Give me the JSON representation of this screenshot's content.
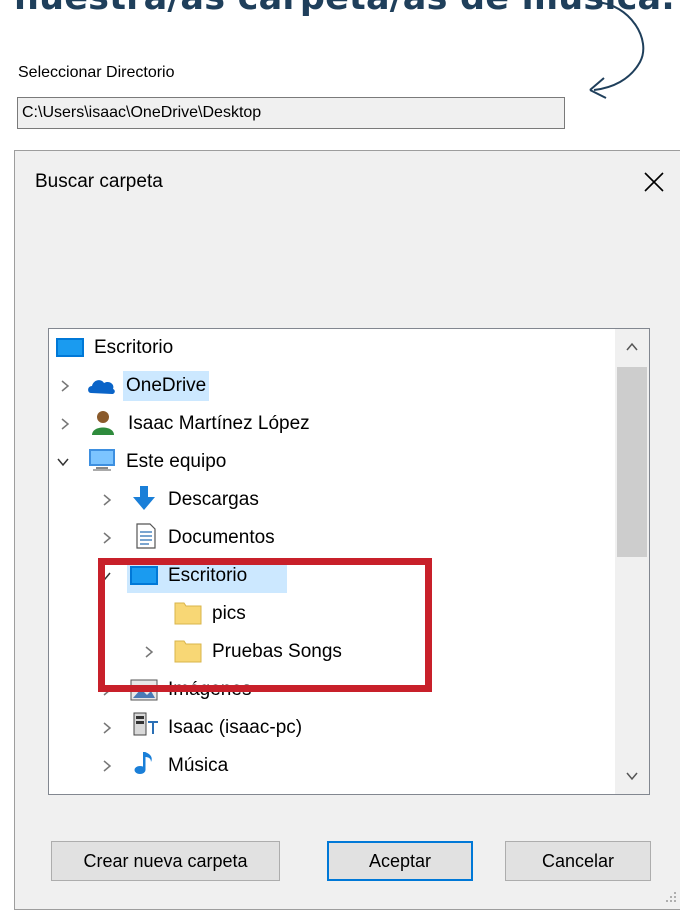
{
  "heading": "nuestra/as carpeta/as de música.",
  "directory": {
    "label": "Seleccionar Directorio",
    "value": "C:\\Users\\isaac\\OneDrive\\Desktop"
  },
  "dialog": {
    "title": "Buscar carpeta",
    "close": "✕",
    "tree": [
      {
        "label": "Escritorio",
        "icon": "desktop-icon"
      },
      {
        "label": "OneDrive",
        "icon": "onedrive-cloud-icon"
      },
      {
        "label": "Isaac Martínez López",
        "icon": "user-icon"
      },
      {
        "label": "Este equipo",
        "icon": "computer-icon"
      },
      {
        "label": "Descargas",
        "icon": "download-arrow-icon"
      },
      {
        "label": "Documentos",
        "icon": "document-icon"
      },
      {
        "label": "Escritorio",
        "icon": "desktop-icon",
        "selected": true
      },
      {
        "label": "pics",
        "icon": "folder-icon"
      },
      {
        "label": "Pruebas Songs",
        "icon": "folder-icon"
      },
      {
        "label": "Imágenes",
        "icon": "pictures-icon"
      },
      {
        "label": "Isaac (isaac-pc)",
        "icon": "network-drive-icon"
      },
      {
        "label": "Música",
        "icon": "music-note-icon"
      }
    ],
    "buttons": {
      "new_folder": "Crear nueva carpeta",
      "accept": "Aceptar",
      "cancel": "Cancelar"
    }
  },
  "colors": {
    "heading": "#1f3f5b",
    "highlight_box": "#c8202a",
    "selection": "#cce8ff",
    "accent": "#0078d7"
  }
}
